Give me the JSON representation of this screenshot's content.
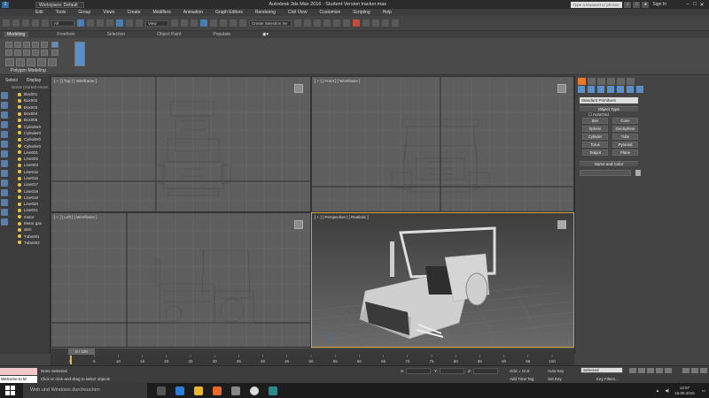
{
  "titlebar": {
    "workspace": "Workspace: Default",
    "title": "Autodesk 3ds Max 2016 - Student Version   tracker.max",
    "search_placeholder": "Type a keyword or phrase",
    "sign_in": "Sign In"
  },
  "menu": [
    "Edit",
    "Tools",
    "Group",
    "Views",
    "Create",
    "Modifiers",
    "Animation",
    "Graph Editors",
    "Rendering",
    "Civil View",
    "Customize",
    "Scripting",
    "Help"
  ],
  "toolbar": {
    "filter": "All",
    "coord_system": "View",
    "selection_set": "Create Selection Se"
  },
  "ribbon": {
    "tabs": [
      "Modeling",
      "Freeform",
      "Selection",
      "Object Paint",
      "Populate"
    ],
    "active_tab": "Modeling",
    "panel_label": "Polygon Modeling"
  },
  "scene_explorer": {
    "tabs": [
      "Select",
      "Display"
    ],
    "header": "Name (Sorted Ascen",
    "items": [
      "Box001",
      "Box002",
      "Box003",
      "Box004",
      "Box005",
      "Cylinder0",
      "Cylinder0",
      "Cylinder0",
      "Cylinder0",
      "Line001",
      "Line002",
      "Line003",
      "Line015",
      "Line016",
      "Line017",
      "Line018",
      "Line019",
      "Line020",
      "Line021",
      "motor",
      "Motor gan",
      "stirn",
      "Tube001",
      "Tube003"
    ]
  },
  "viewports": {
    "top": "[ + ] [ Top ] [ Wireframe ]",
    "front": "[ + ] [ Front ] [ Wireframe ]",
    "left": "[ + ] [ Left ] [ Wireframe ]",
    "perspective": "[ + ] [ Perspective ] [ Realistic ]"
  },
  "command_panel": {
    "category": "Standard Primitives",
    "object_type_title": "Object Type",
    "autogrid": "AutoGrid",
    "buttons": [
      "Box",
      "Cone",
      "Sphere",
      "GeoSphere",
      "Cylinder",
      "Tube",
      "Torus",
      "Pyramid",
      "Teapot",
      "Plane"
    ],
    "name_color_title": "Name and Color"
  },
  "timeline": {
    "frame_label": "0 / 100",
    "ticks": [
      "0",
      "5",
      "10",
      "15",
      "20",
      "25",
      "30",
      "35",
      "40",
      "45",
      "50",
      "55",
      "60",
      "65",
      "70",
      "75",
      "80",
      "85",
      "90",
      "95",
      "100"
    ]
  },
  "status": {
    "welcome": "Welcome to M",
    "selected": "None Selected",
    "prompt": "Click or click-and-drag to select objects",
    "x": "X:",
    "y": "Y:",
    "z": "Z:",
    "grid": "Grid = 10,0",
    "add_time_tag": "Add Time Tag",
    "auto_key": "Auto Key",
    "set_key": "Set Key",
    "selected_dropdown": "Selected",
    "key_filters": "Key Filters..."
  },
  "taskbar": {
    "search": "Web und Windows durchsuchen",
    "time": "13:57",
    "date": "16.08.2015"
  }
}
